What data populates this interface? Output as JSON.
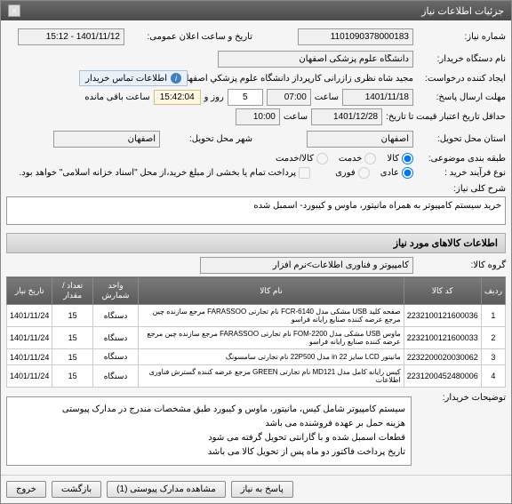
{
  "window": {
    "title": "جزئیات اطلاعات نیاز"
  },
  "f": {
    "need_no_label": "شماره نیاز:",
    "need_no": "1101090378000183",
    "announce_label": "تاریخ و ساعت اعلان عمومی:",
    "announce": "1401/11/12 - 15:12",
    "buyer_label": "نام دستگاه خریدار:",
    "buyer": "دانشگاه علوم پزشکی اصفهان",
    "creator_label": "ایجاد کننده درخواست:",
    "creator": "مجید شاه نظری زازرانی کارپرداز دانشگاه علوم پزشکي اصفهان",
    "info_box": "اطلاعات تماس خریدار",
    "reply_deadline_label": "مهلت ارسال پاسخ:",
    "reply_date": "1401/11/18",
    "time_label": "ساعت",
    "reply_time": "07:00",
    "days_sep": "روز و",
    "days_val": "5",
    "countdown": "15:42:04",
    "remain": "ساعت باقی مانده",
    "price_validity_label": "حداقل تاریخ اعتبار قیمت تا تاریخ:",
    "price_date": "1401/12/28",
    "price_time": "10:00",
    "need_city_label": "استان محل تحویل:",
    "need_city": "اصفهان",
    "deliver_city_label": "شهر محل تحویل:",
    "deliver_city": "اصفهان",
    "class_label": "طبقه بندی موضوعی:",
    "o_item": "کالا",
    "o_service": "خدمت",
    "o_both": "کالا/خدمت",
    "process_label": "نوع فرآیند خرید :",
    "o_normal": "عادی",
    "o_urgent": "فوری",
    "pay_note": "پرداخت تمام یا بخشی از مبلغ خرید،از محل \"اسناد خزانه اسلامی\" خواهد بود.",
    "desc_label": "شرح کلی نیاز:",
    "desc": "خرید سیستم کامپیوتر به همراه مانیتور، ماوس و کیبورد- اسمبل شده",
    "items_header": "اطلاعات کالاهای مورد نیاز",
    "group_label": "گروه کالا:",
    "group": "کامپیوتر و فناوری اطلاعات>نرم افزار",
    "buyer_notes_label": "توضیحات خریدار:",
    "buyer_notes": "سیستم کامپیوتر شامل کیس، مانیتور، ماوس و کیبورد طبق مشخصات مندرج در مدارک پیوستی\nهزینه حمل بر عهده فروشنده می باشد\nقطعات اسمبل شده و با گارانتی تحویل گرفته می شود\nتاریخ پرداخت فاکتور دو ماه پس از تحویل کالا می باشد"
  },
  "table": {
    "headers": [
      "ردیف",
      "کد کالا",
      "نام کالا",
      "واحد شمارش",
      "تعداد / مقدار",
      "تاریخ نیاز"
    ],
    "rows": [
      {
        "n": "1",
        "code": "2232100121600036",
        "name": "صفحه کلید USB مشکی مدل FCR-6140 نام تجارتی FARASSOO مرجع سازنده چین مرجع عرضه کننده صنایع رایانه فراسو",
        "unit": "دستگاه",
        "qty": "15",
        "date": "1401/11/24"
      },
      {
        "n": "2",
        "code": "2232100121600033",
        "name": "ماوس USB مشکی مدل FOM-2200 نام تجارتی FARASSOO مرجع سازنده چین مرجع عرضه کننده صنایع رایانه فراسو",
        "unit": "دستگاه",
        "qty": "15",
        "date": "1401/11/24"
      },
      {
        "n": "3",
        "code": "2232200020030062",
        "name": "مانیتور LCD سایز 22 in مدل 22P500 نام تجارتی سامسونگ",
        "unit": "دستگاه",
        "qty": "15",
        "date": "1401/11/24"
      },
      {
        "n": "4",
        "code": "2231200452480006",
        "name": "کیس رایانه کامل مدل MD121 نام تجارتی GREEN مرجع عرضه کننده گسترش فناوری اطلاعات",
        "unit": "دستگاه",
        "qty": "15",
        "date": "1401/11/24"
      }
    ]
  },
  "footer": {
    "exit": "خروج",
    "back": "بازگشت",
    "docs": "مشاهده مدارک پیوستی (1)",
    "reply": "پاسخ به نیاز"
  }
}
